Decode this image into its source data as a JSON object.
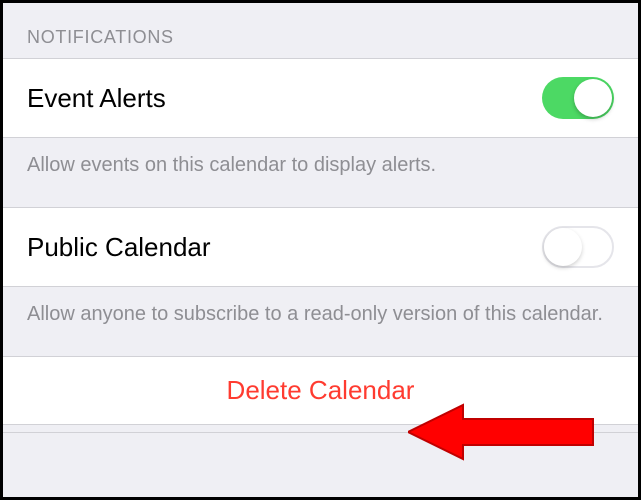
{
  "section": {
    "header": "NOTIFICATIONS"
  },
  "eventAlerts": {
    "label": "Event Alerts",
    "footer": "Allow events on this calendar to display alerts.",
    "enabled": true
  },
  "publicCalendar": {
    "label": "Public Calendar",
    "footer": "Allow anyone to subscribe to a read-only version of this calendar.",
    "enabled": false
  },
  "delete": {
    "label": "Delete Calendar"
  },
  "colors": {
    "toggleOn": "#4cd964",
    "destructive": "#ff3b30"
  }
}
